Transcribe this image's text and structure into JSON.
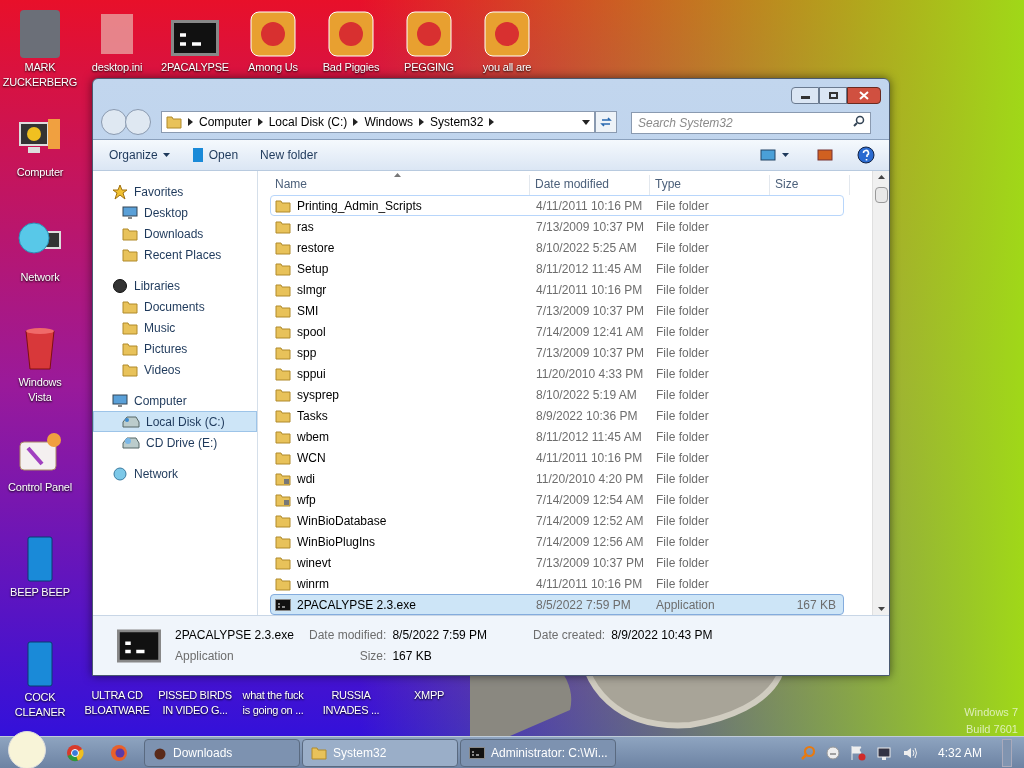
{
  "desktop": {
    "left_column": [
      {
        "label": "MARK\nZUCKERBERG",
        "kind": "photo"
      },
      {
        "label": "Computer",
        "kind": "computer"
      },
      {
        "label": "Network",
        "kind": "network"
      },
      {
        "label": "Windows\nVista",
        "kind": "bin"
      },
      {
        "label": "Control Panel",
        "kind": "panel"
      },
      {
        "label": "BEEP BEEP",
        "kind": "book"
      },
      {
        "label": "COCK\nCLEANER",
        "kind": "book"
      }
    ],
    "top_row": [
      {
        "label": "desktop.ini",
        "kind": "file"
      },
      {
        "label": "2PACALYPSE",
        "kind": "terminal"
      },
      {
        "label": "Among Us",
        "kind": "app"
      },
      {
        "label": "Bad Piggies",
        "kind": "app"
      },
      {
        "label": "PEGGING",
        "kind": "app"
      },
      {
        "label": "you all are",
        "kind": "app"
      }
    ],
    "bottom_row": [
      {
        "label": "ULTRA CD\nBLOATWARE"
      },
      {
        "label": "PISSED BIRDS\nIN VIDEO G..."
      },
      {
        "label": "what the fuck\nis going on ..."
      },
      {
        "label": "RUSSIA\nINVADES ..."
      },
      {
        "label": "XMPP"
      }
    ],
    "watermark": [
      "Windows 7",
      "Build 7601"
    ]
  },
  "window": {
    "address": [
      "Computer",
      "Local Disk (C:)",
      "Windows",
      "System32"
    ],
    "search": {
      "placeholder": "Search System32"
    },
    "toolbar": [
      {
        "label": "Organize",
        "kind": "menu"
      },
      {
        "label": "Open",
        "kind": "open"
      },
      {
        "label": "New folder",
        "kind": "plain"
      }
    ],
    "nav": [
      {
        "label": "Favorites",
        "kind": "star",
        "selected": false,
        "children": [
          {
            "label": "Desktop",
            "kind": "monitor",
            "selected": false
          },
          {
            "label": "Downloads",
            "kind": "folder",
            "selected": false
          },
          {
            "label": "Recent Places",
            "kind": "folder",
            "selected": false
          }
        ]
      },
      {
        "label": "Libraries",
        "kind": "library",
        "selected": false,
        "children": [
          {
            "label": "Documents",
            "kind": "folder",
            "selected": false
          },
          {
            "label": "Music",
            "kind": "folder",
            "selected": false
          },
          {
            "label": "Pictures",
            "kind": "folder",
            "selected": false
          },
          {
            "label": "Videos",
            "kind": "folder",
            "selected": false
          }
        ]
      },
      {
        "label": "Computer",
        "kind": "monitor",
        "selected": false,
        "children": [
          {
            "label": "Local Disk (C:)",
            "kind": "drive",
            "selected": true
          },
          {
            "label": "CD Drive (E:)",
            "kind": "disc",
            "selected": false
          }
        ]
      },
      {
        "label": "Network",
        "kind": "globe",
        "selected": false
      }
    ],
    "columns": [
      "Name",
      "Date modified",
      "Type",
      "Size"
    ],
    "rows": [
      {
        "name": "Printing_Admin_Scripts",
        "date": "4/11/2011 10:16 PM",
        "type": "File folder",
        "kind": "folder",
        "selected": false,
        "hovered": true
      },
      {
        "name": "ras",
        "date": "7/13/2009 10:37 PM",
        "type": "File folder",
        "kind": "folder",
        "selected": false,
        "hovered": false
      },
      {
        "name": "restore",
        "date": "8/10/2022 5:25 AM",
        "type": "File folder",
        "kind": "folder",
        "selected": false,
        "hovered": false
      },
      {
        "name": "Setup",
        "date": "8/11/2012 11:45 AM",
        "type": "File folder",
        "kind": "folder",
        "selected": false,
        "hovered": false
      },
      {
        "name": "slmgr",
        "date": "4/11/2011 10:16 PM",
        "type": "File folder",
        "kind": "folder",
        "selected": false,
        "hovered": false
      },
      {
        "name": "SMI",
        "date": "7/13/2009 10:37 PM",
        "type": "File folder",
        "kind": "folder",
        "selected": false,
        "hovered": false
      },
      {
        "name": "spool",
        "date": "7/14/2009 12:41 AM",
        "type": "File folder",
        "kind": "folder",
        "selected": false,
        "hovered": false
      },
      {
        "name": "spp",
        "date": "7/13/2009 10:37 PM",
        "type": "File folder",
        "kind": "folder",
        "selected": false,
        "hovered": false
      },
      {
        "name": "sppui",
        "date": "11/20/2010 4:33 PM",
        "type": "File folder",
        "kind": "folder",
        "selected": false,
        "hovered": false
      },
      {
        "name": "sysprep",
        "date": "8/10/2022 5:19 AM",
        "type": "File folder",
        "kind": "folder",
        "selected": false,
        "hovered": false
      },
      {
        "name": "Tasks",
        "date": "8/9/2022 10:36 PM",
        "type": "File folder",
        "kind": "folder",
        "selected": false,
        "hovered": false
      },
      {
        "name": "wbem",
        "date": "8/11/2012 11:45 AM",
        "type": "File folder",
        "kind": "folder",
        "selected": false,
        "hovered": false
      },
      {
        "name": "WCN",
        "date": "4/11/2011 10:16 PM",
        "type": "File folder",
        "kind": "folder",
        "selected": false,
        "hovered": false
      },
      {
        "name": "wdi",
        "date": "11/20/2010 4:20 PM",
        "type": "File folder",
        "kind": "locked",
        "selected": false,
        "hovered": false
      },
      {
        "name": "wfp",
        "date": "7/14/2009 12:54 AM",
        "type": "File folder",
        "kind": "locked",
        "selected": false,
        "hovered": false
      },
      {
        "name": "WinBioDatabase",
        "date": "7/14/2009 12:52 AM",
        "type": "File folder",
        "kind": "folder",
        "selected": false,
        "hovered": false
      },
      {
        "name": "WinBioPlugIns",
        "date": "7/14/2009 12:56 AM",
        "type": "File folder",
        "kind": "folder",
        "selected": false,
        "hovered": false
      },
      {
        "name": "winevt",
        "date": "7/13/2009 10:37 PM",
        "type": "File folder",
        "kind": "folder",
        "selected": false,
        "hovered": false
      },
      {
        "name": "winrm",
        "date": "4/11/2011 10:16 PM",
        "type": "File folder",
        "kind": "folder",
        "selected": false,
        "hovered": false
      },
      {
        "name": "2PACALYPSE 2.3.exe",
        "date": "8/5/2022 7:59 PM",
        "type": "Application",
        "size": "167 KB",
        "kind": "app",
        "selected": true,
        "hovered": false
      }
    ],
    "details": {
      "name": "2PACALYPSE 2.3.exe",
      "type": "Application",
      "fields": [
        {
          "label": "Date modified:",
          "value": "8/5/2022 7:59 PM"
        },
        {
          "label": "Date created:",
          "value": "8/9/2022 10:43 PM"
        },
        {
          "label": "Size:",
          "value": "167 KB"
        }
      ]
    }
  },
  "taskbar": {
    "tasks": [
      {
        "label": "Downloads",
        "kind": "app",
        "selected": false
      },
      {
        "label": "System32",
        "kind": "folder",
        "selected": true
      },
      {
        "label": "Administrator: C:\\Wi...",
        "kind": "terminal",
        "selected": false
      }
    ],
    "clock": "4:32 AM"
  }
}
